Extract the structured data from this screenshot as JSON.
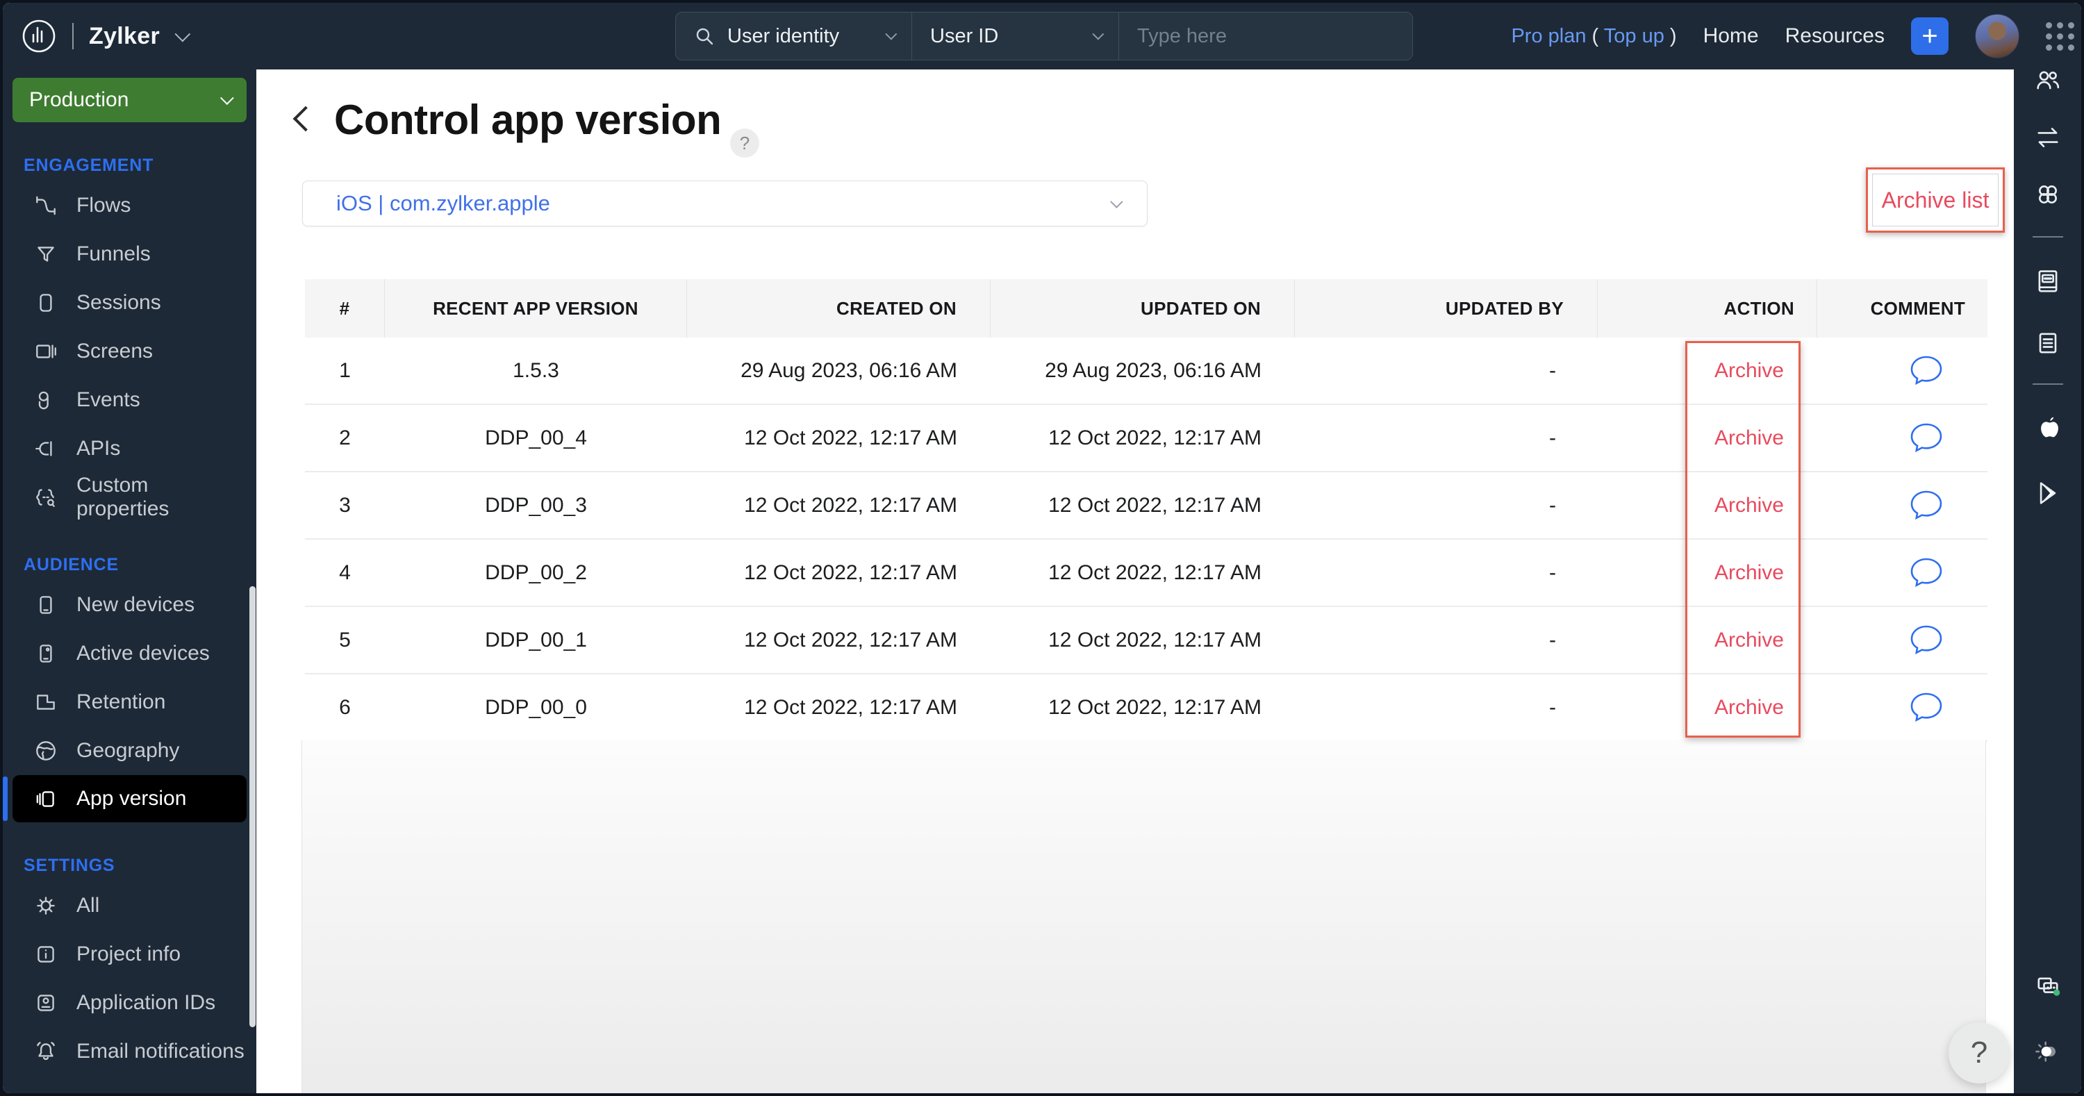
{
  "topbar": {
    "brand": "Zylker",
    "search": {
      "category": "User identity",
      "field": "User ID",
      "placeholder": "Type here"
    },
    "plan": {
      "name": "Pro plan",
      "open": "(",
      "topup": "Top up",
      "close": ")"
    },
    "nav": {
      "home": "Home",
      "resources": "Resources"
    },
    "plus": "+"
  },
  "sidebar": {
    "environment": "Production",
    "sections": [
      {
        "label": "ENGAGEMENT",
        "items": [
          {
            "icon": "flows-icon",
            "label": "Flows"
          },
          {
            "icon": "funnel-icon",
            "label": "Funnels"
          },
          {
            "icon": "sessions-icon",
            "label": "Sessions"
          },
          {
            "icon": "screens-icon",
            "label": "Screens"
          },
          {
            "icon": "events-icon",
            "label": "Events"
          },
          {
            "icon": "apis-icon",
            "label": "APIs"
          },
          {
            "icon": "custom-properties-icon",
            "label": "Custom properties"
          }
        ]
      },
      {
        "label": "AUDIENCE",
        "items": [
          {
            "icon": "new-devices-icon",
            "label": "New devices"
          },
          {
            "icon": "active-devices-icon",
            "label": "Active devices"
          },
          {
            "icon": "retention-icon",
            "label": "Retention"
          },
          {
            "icon": "geography-icon",
            "label": "Geography"
          },
          {
            "icon": "app-version-icon",
            "label": "App version",
            "selected": true
          }
        ]
      },
      {
        "label": "SETTINGS",
        "items": [
          {
            "icon": "gear-icon",
            "label": "All"
          },
          {
            "icon": "info-icon",
            "label": "Project info"
          },
          {
            "icon": "id-card-icon",
            "label": "Application IDs"
          },
          {
            "icon": "bell-icon",
            "label": "Email notifications"
          }
        ]
      }
    ]
  },
  "main": {
    "title": "Control app version",
    "help_badge": "?",
    "app_selector": "iOS | com.zylker.apple",
    "archive_list_button": "Archive list",
    "table": {
      "columns": [
        {
          "label": "#"
        },
        {
          "label": "RECENT APP VERSION"
        },
        {
          "label": "CREATED ON"
        },
        {
          "label": "UPDATED ON"
        },
        {
          "label": "UPDATED BY"
        },
        {
          "label": "ACTION"
        },
        {
          "label": "COMMENT"
        }
      ],
      "rows": [
        {
          "num": "1",
          "version": "1.5.3",
          "created": "29 Aug 2023, 06:16 AM",
          "updated": "29 Aug 2023, 06:16 AM",
          "updated_by": "-",
          "action": "Archive"
        },
        {
          "num": "2",
          "version": "DDP_00_4",
          "created": "12 Oct 2022, 12:17 AM",
          "updated": "12 Oct 2022, 12:17 AM",
          "updated_by": "-",
          "action": "Archive"
        },
        {
          "num": "3",
          "version": "DDP_00_3",
          "created": "12 Oct 2022, 12:17 AM",
          "updated": "12 Oct 2022, 12:17 AM",
          "updated_by": "-",
          "action": "Archive"
        },
        {
          "num": "4",
          "version": "DDP_00_2",
          "created": "12 Oct 2022, 12:17 AM",
          "updated": "12 Oct 2022, 12:17 AM",
          "updated_by": "-",
          "action": "Archive"
        },
        {
          "num": "5",
          "version": "DDP_00_1",
          "created": "12 Oct 2022, 12:17 AM",
          "updated": "12 Oct 2022, 12:17 AM",
          "updated_by": "-",
          "action": "Archive"
        },
        {
          "num": "6",
          "version": "DDP_00_0",
          "created": "12 Oct 2022, 12:17 AM",
          "updated": "12 Oct 2022, 12:17 AM",
          "updated_by": "-",
          "action": "Archive"
        }
      ]
    }
  },
  "help_button": "?",
  "colors": {
    "topbar_bg": "#1d2936",
    "accent_blue": "#2e6ff2",
    "production_green": "#3e7c31",
    "archive_red": "#e84a5e",
    "annotation_red": "#e8604c",
    "selected_item_bg": "#000000"
  }
}
